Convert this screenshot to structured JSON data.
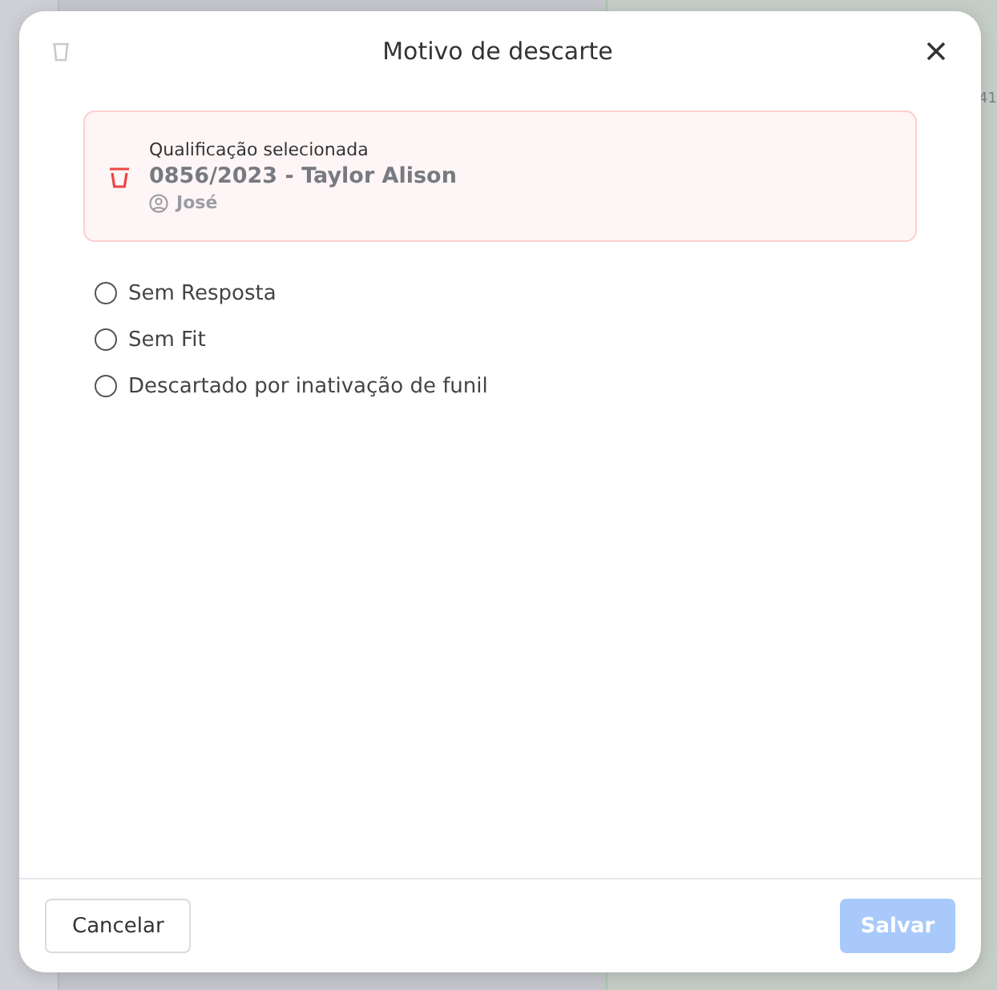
{
  "background": {
    "text": "41"
  },
  "dialog": {
    "title": "Motivo de descarte",
    "selection": {
      "label": "Qualificação selecionada",
      "name": "0856/2023 - Taylor Alison",
      "owner": "José"
    },
    "reasons": [
      {
        "label": "Sem Resposta",
        "selected": false
      },
      {
        "label": "Sem Fit",
        "selected": false
      },
      {
        "label": "Descartado por inativação de funil",
        "selected": false
      }
    ],
    "cancel": {
      "label": "Cancelar"
    },
    "save": {
      "label": "Salvar",
      "disabled": true
    }
  }
}
